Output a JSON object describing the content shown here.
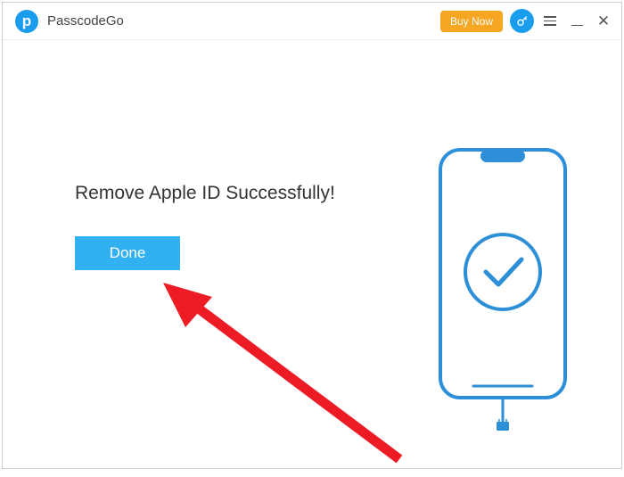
{
  "app": {
    "title": "PasscodeGo",
    "logo_letter": "p"
  },
  "titlebar": {
    "buy_now": "Buy Now"
  },
  "main": {
    "status_message": "Remove Apple ID Successfully!",
    "done_label": "Done"
  },
  "colors": {
    "accent": "#1b9dee",
    "button": "#31b1f1",
    "buy_now": "#f5a623",
    "arrow": "#ed1c24"
  }
}
